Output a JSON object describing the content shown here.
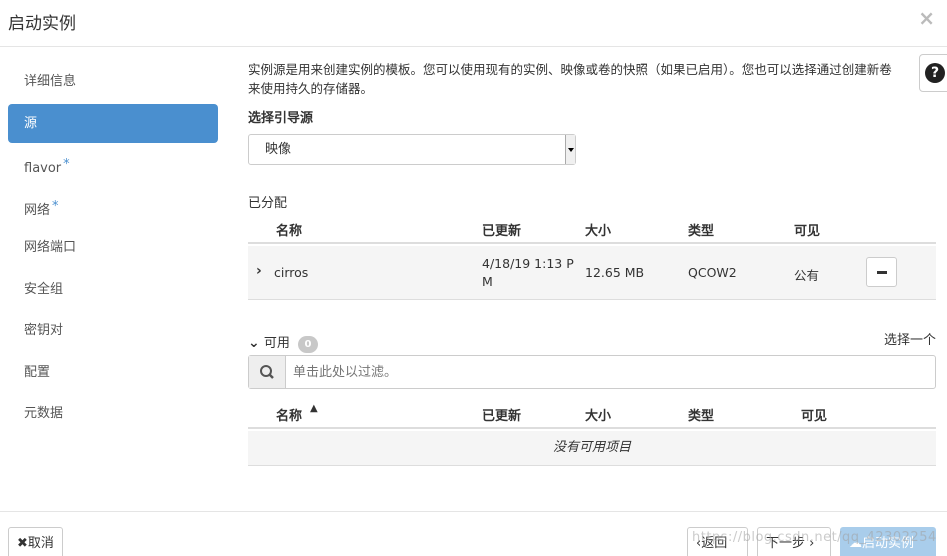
{
  "modal": {
    "title": "启动实例",
    "close": "×"
  },
  "sidebar": {
    "items": [
      {
        "label": "详细信息",
        "required": false,
        "active": false
      },
      {
        "label": "源",
        "required": false,
        "active": true
      },
      {
        "label": "flavor",
        "required": true,
        "active": false
      },
      {
        "label": "网络",
        "required": true,
        "active": false
      },
      {
        "label": "网络端口",
        "required": false,
        "active": false
      },
      {
        "label": "安全组",
        "required": false,
        "active": false
      },
      {
        "label": "密钥对",
        "required": false,
        "active": false
      },
      {
        "label": "配置",
        "required": false,
        "active": false
      },
      {
        "label": "元数据",
        "required": false,
        "active": false
      }
    ],
    "required_mark": "*"
  },
  "help": {
    "icon": "question-circle-icon",
    "glyph": "?"
  },
  "main": {
    "description_line1": "实例源是用来创建实例的模板。您可以使用现有的实例、映像或卷的快照（如果已启用）。您也可以选择通过创建新卷",
    "description_line2": "来使用持久的存储器。",
    "boot_source_label": "选择引导源",
    "boot_source_value": "映像"
  },
  "allocated": {
    "label": "已分配",
    "columns": [
      "名称",
      "已更新",
      "大小",
      "类型",
      "可见"
    ],
    "rows": [
      {
        "name": "cirros",
        "updated_line1": "4/18/19 1:13 P",
        "updated_line2": "M",
        "size": "12.65 MB",
        "type": "QCOW2",
        "visibility": "公有"
      }
    ]
  },
  "available": {
    "label": "可用",
    "count": "0",
    "select_one": "选择一个",
    "filter_placeholder": "单击此处以过滤。",
    "columns": [
      "名称",
      "已更新",
      "大小",
      "类型",
      "可见"
    ],
    "empty_text": "没有可用项目"
  },
  "footer": {
    "cancel": "✖取消",
    "back": "‹返回",
    "next": "下一步 ›",
    "launch": "启动实例"
  },
  "watermark": "https://blog.csdn.net/qq_42302254"
}
